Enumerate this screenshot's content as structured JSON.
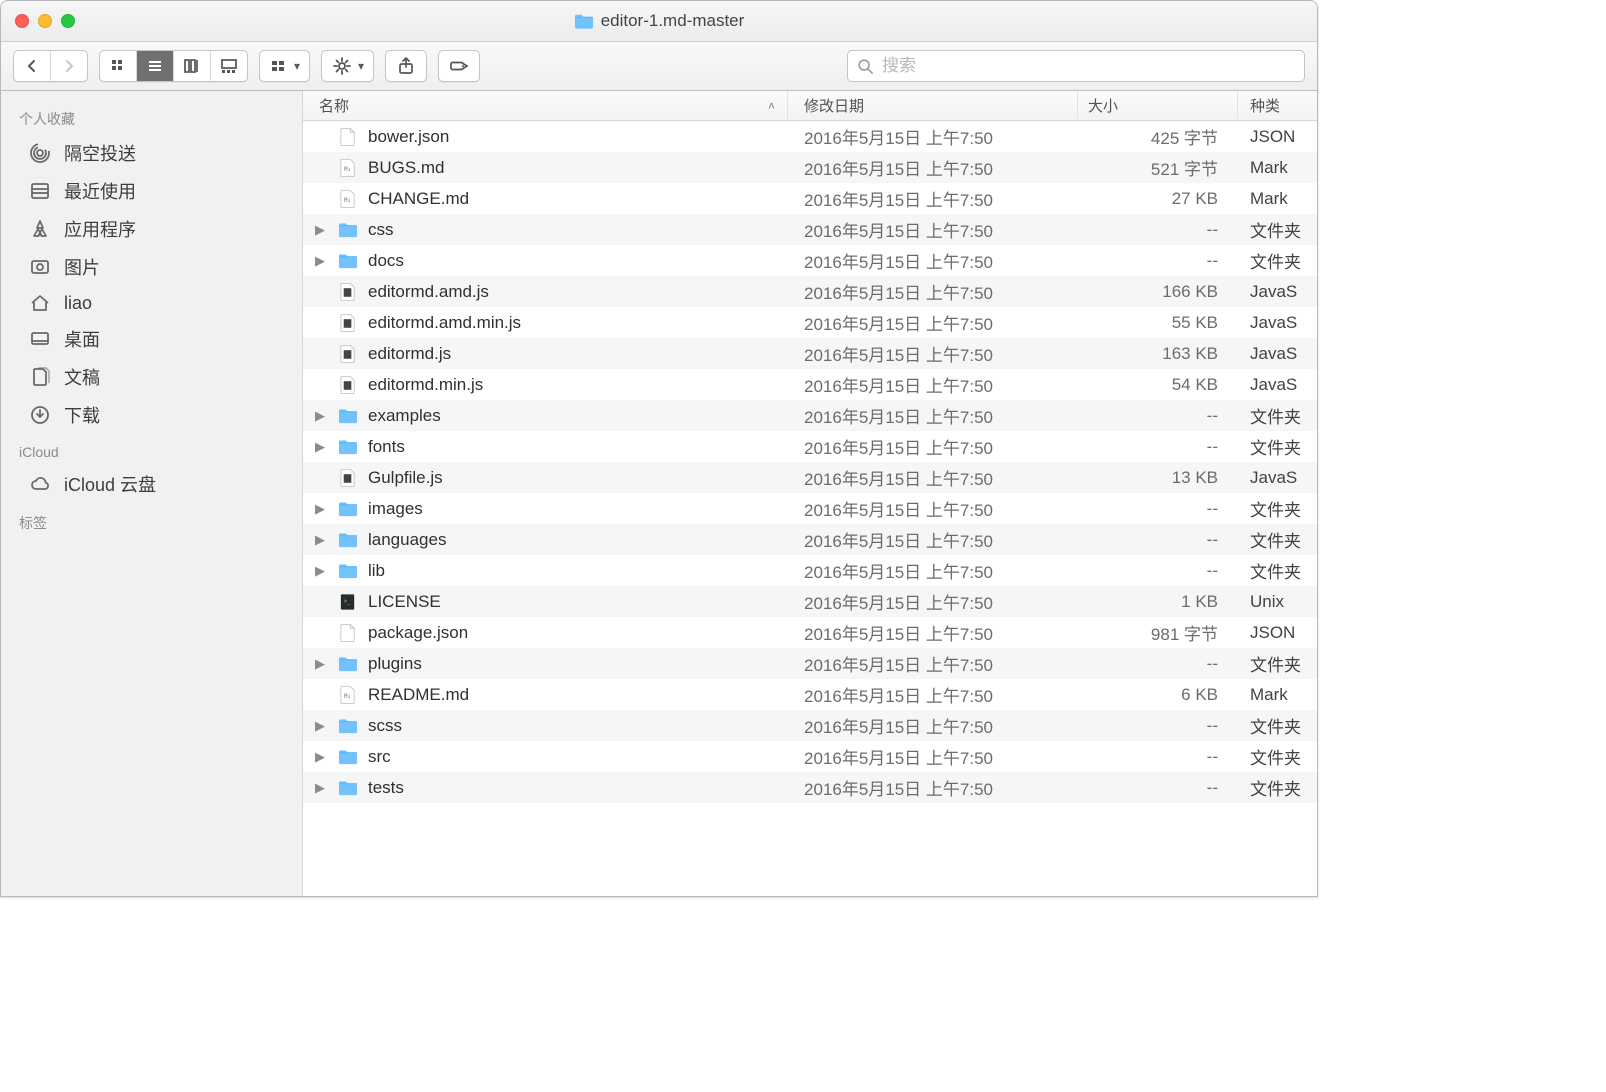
{
  "window": {
    "title": "editor-1.md-master"
  },
  "search": {
    "placeholder": "搜索"
  },
  "sidebar": {
    "sections": [
      {
        "header": "个人收藏",
        "items": [
          {
            "icon": "airdrop",
            "label": "隔空投送"
          },
          {
            "icon": "recents",
            "label": "最近使用"
          },
          {
            "icon": "apps",
            "label": "应用程序"
          },
          {
            "icon": "pictures",
            "label": "图片"
          },
          {
            "icon": "home",
            "label": "liao"
          },
          {
            "icon": "desktop",
            "label": "桌面"
          },
          {
            "icon": "documents",
            "label": "文稿"
          },
          {
            "icon": "downloads",
            "label": "下载"
          }
        ]
      },
      {
        "header": "iCloud",
        "items": [
          {
            "icon": "cloud",
            "label": "iCloud 云盘"
          }
        ]
      },
      {
        "header": "标签",
        "items": []
      }
    ]
  },
  "columns": {
    "name": "名称",
    "date": "修改日期",
    "size": "大小",
    "kind": "种类"
  },
  "files": [
    {
      "folder": false,
      "icon": "blank",
      "name": "bower.json",
      "date": "2016年5月15日 上午7:50",
      "size": "425 字节",
      "kind": "JSON"
    },
    {
      "folder": false,
      "icon": "md",
      "name": "BUGS.md",
      "date": "2016年5月15日 上午7:50",
      "size": "521 字节",
      "kind": "Mark"
    },
    {
      "folder": false,
      "icon": "md",
      "name": "CHANGE.md",
      "date": "2016年5月15日 上午7:50",
      "size": "27 KB",
      "kind": "Mark"
    },
    {
      "folder": true,
      "icon": "fold",
      "name": "css",
      "date": "2016年5月15日 上午7:50",
      "size": "--",
      "kind": "文件夹"
    },
    {
      "folder": true,
      "icon": "fold",
      "name": "docs",
      "date": "2016年5月15日 上午7:50",
      "size": "--",
      "kind": "文件夹"
    },
    {
      "folder": false,
      "icon": "js",
      "name": "editormd.amd.js",
      "date": "2016年5月15日 上午7:50",
      "size": "166 KB",
      "kind": "JavaS"
    },
    {
      "folder": false,
      "icon": "js",
      "name": "editormd.amd.min.js",
      "date": "2016年5月15日 上午7:50",
      "size": "55 KB",
      "kind": "JavaS"
    },
    {
      "folder": false,
      "icon": "js",
      "name": "editormd.js",
      "date": "2016年5月15日 上午7:50",
      "size": "163 KB",
      "kind": "JavaS"
    },
    {
      "folder": false,
      "icon": "js",
      "name": "editormd.min.js",
      "date": "2016年5月15日 上午7:50",
      "size": "54 KB",
      "kind": "JavaS"
    },
    {
      "folder": true,
      "icon": "fold",
      "name": "examples",
      "date": "2016年5月15日 上午7:50",
      "size": "--",
      "kind": "文件夹"
    },
    {
      "folder": true,
      "icon": "fold",
      "name": "fonts",
      "date": "2016年5月15日 上午7:50",
      "size": "--",
      "kind": "文件夹"
    },
    {
      "folder": false,
      "icon": "js",
      "name": "Gulpfile.js",
      "date": "2016年5月15日 上午7:50",
      "size": "13 KB",
      "kind": "JavaS"
    },
    {
      "folder": true,
      "icon": "fold",
      "name": "images",
      "date": "2016年5月15日 上午7:50",
      "size": "--",
      "kind": "文件夹"
    },
    {
      "folder": true,
      "icon": "fold",
      "name": "languages",
      "date": "2016年5月15日 上午7:50",
      "size": "--",
      "kind": "文件夹"
    },
    {
      "folder": true,
      "icon": "fold",
      "name": "lib",
      "date": "2016年5月15日 上午7:50",
      "size": "--",
      "kind": "文件夹"
    },
    {
      "folder": false,
      "icon": "exec",
      "name": "LICENSE",
      "date": "2016年5月15日 上午7:50",
      "size": "1 KB",
      "kind": "Unix"
    },
    {
      "folder": false,
      "icon": "blank",
      "name": "package.json",
      "date": "2016年5月15日 上午7:50",
      "size": "981 字节",
      "kind": "JSON"
    },
    {
      "folder": true,
      "icon": "fold",
      "name": "plugins",
      "date": "2016年5月15日 上午7:50",
      "size": "--",
      "kind": "文件夹"
    },
    {
      "folder": false,
      "icon": "md",
      "name": "README.md",
      "date": "2016年5月15日 上午7:50",
      "size": "6 KB",
      "kind": "Mark"
    },
    {
      "folder": true,
      "icon": "fold",
      "name": "scss",
      "date": "2016年5月15日 上午7:50",
      "size": "--",
      "kind": "文件夹"
    },
    {
      "folder": true,
      "icon": "fold",
      "name": "src",
      "date": "2016年5月15日 上午7:50",
      "size": "--",
      "kind": "文件夹"
    },
    {
      "folder": true,
      "icon": "fold",
      "name": "tests",
      "date": "2016年5月15日 上午7:50",
      "size": "--",
      "kind": "文件夹"
    }
  ]
}
